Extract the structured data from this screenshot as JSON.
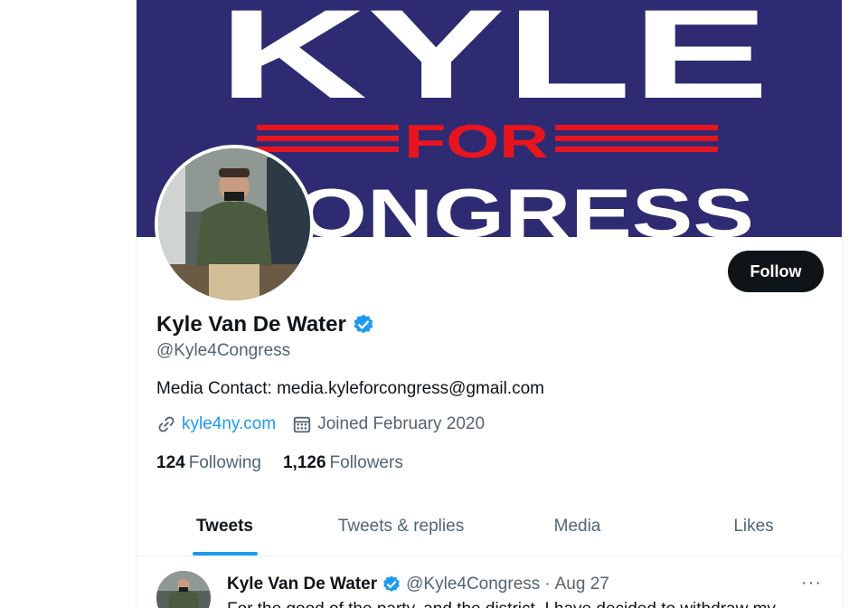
{
  "banner": {
    "line1": "KYLE",
    "line2": "FOR",
    "line3": "CONGRESS"
  },
  "profile": {
    "display_name": "Kyle Van De Water",
    "handle": "@Kyle4Congress",
    "bio": "Media Contact: media.kyleforcongress@gmail.com",
    "website": "kyle4ny.com",
    "joined": "Joined February 2020",
    "following_count": "124",
    "following_label": "Following",
    "followers_count": "1,126",
    "followers_label": "Followers",
    "verified": true
  },
  "actions": {
    "follow_label": "Follow"
  },
  "tabs": [
    {
      "label": "Tweets",
      "active": true
    },
    {
      "label": "Tweets & replies",
      "active": false
    },
    {
      "label": "Media",
      "active": false
    },
    {
      "label": "Likes",
      "active": false
    }
  ],
  "tweet": {
    "name": "Kyle Van De Water",
    "handle": "@Kyle4Congress",
    "separator": "·",
    "date": "Aug 27",
    "more": "···",
    "text": "For the good of the party, and the district, I have decided to withdraw my"
  },
  "colors": {
    "banner_bg": "#2e2b73",
    "banner_red": "#e8151e",
    "accent": "#1d9bf0",
    "text_primary": "#0f1419",
    "text_secondary": "#536471"
  },
  "icons": {
    "verified": "verified-badge-icon",
    "link": "link-icon",
    "calendar": "calendar-icon",
    "more": "more-horizontal-icon"
  }
}
